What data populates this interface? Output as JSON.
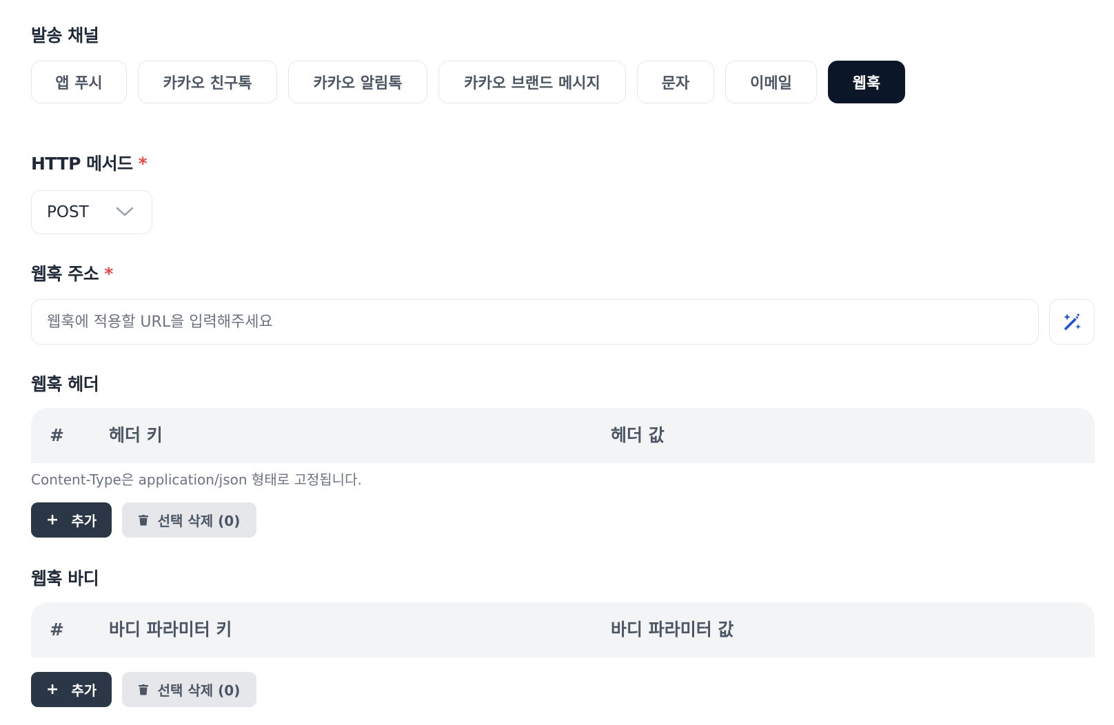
{
  "channel": {
    "title": "발송 채널",
    "options": [
      {
        "label": "앱 푸시",
        "active": false
      },
      {
        "label": "카카오 친구톡",
        "active": false
      },
      {
        "label": "카카오 알림톡",
        "active": false
      },
      {
        "label": "카카오 브랜드 메시지",
        "active": false
      },
      {
        "label": "문자",
        "active": false
      },
      {
        "label": "이메일",
        "active": false
      },
      {
        "label": "웹훅",
        "active": true
      }
    ]
  },
  "method": {
    "title": "HTTP 메서드",
    "required_mark": "*",
    "value": "POST"
  },
  "url": {
    "title": "웹훅 주소",
    "required_mark": "*",
    "placeholder": "웹훅에 적용할 URL을 입력해주세요",
    "value": "",
    "magic_icon": "magic-wand-icon"
  },
  "headers": {
    "title": "웹훅 헤더",
    "columns": {
      "index": "#",
      "key": "헤더 키",
      "value": "헤더 값"
    },
    "note": "Content-Type은 application/json 형태로 고정됩니다.",
    "add_label": "추가",
    "add_icon_text": "+",
    "delete_label": "선택 삭제 (0)",
    "delete_icon": "trash-icon"
  },
  "body": {
    "title": "웹훅 바디",
    "columns": {
      "index": "#",
      "key": "바디 파라미터 키",
      "value": "바디 파라미터 값"
    },
    "add_label": "추가",
    "add_icon_text": "+",
    "delete_label": "선택 삭제 (0)",
    "delete_icon": "trash-icon"
  },
  "colors": {
    "active_chip": "#0b1628",
    "required": "#ef4444",
    "add_button": "#2b3646",
    "magic_icon": "#1d4ed8"
  }
}
